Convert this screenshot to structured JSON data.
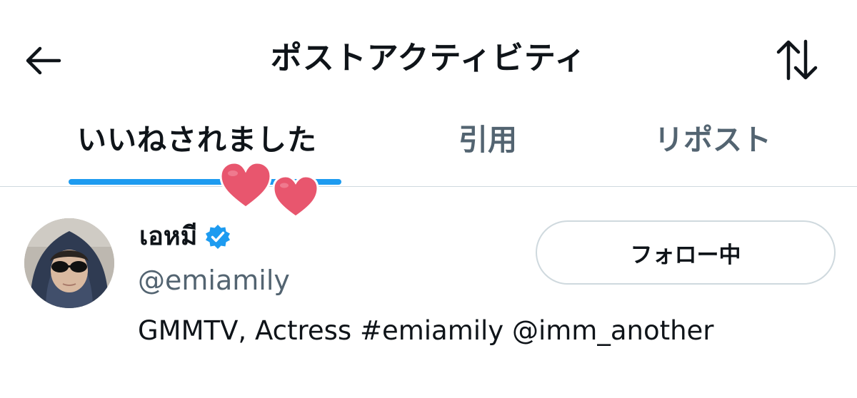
{
  "header": {
    "title": "ポストアクティビティ",
    "back_icon": "arrow-left-icon",
    "sort_icon": "sort-arrows-icon"
  },
  "tabs": [
    {
      "label": "いいねされました",
      "active": true
    },
    {
      "label": "引用",
      "active": false
    },
    {
      "label": "リポスト",
      "active": false
    }
  ],
  "colors": {
    "accent": "#1d9bf0",
    "text": "#0f1419",
    "secondary_text": "#536471",
    "divider": "#cfd9de",
    "sticker_heart": "#e8566e"
  },
  "user": {
    "name": "เอหมี",
    "verified_icon": "verified-badge-icon",
    "handle": "@emiamily",
    "bio": "GMMTV, Actress #emiamily @imm_another",
    "follow_button_label": "フォロー中"
  }
}
